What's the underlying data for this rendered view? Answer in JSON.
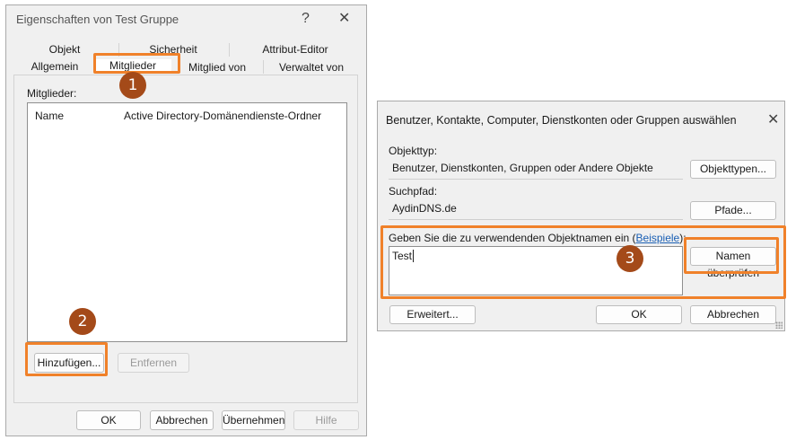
{
  "left_dialog": {
    "title": "Eigenschaften von Test Gruppe",
    "help_glyph": "?",
    "close_glyph": "✕",
    "tabs_row1": [
      "Objekt",
      "Sicherheit",
      "Attribut-Editor"
    ],
    "tabs_row2": [
      "Allgemein",
      "Mitglieder",
      "Mitglied von",
      "Verwaltet von"
    ],
    "members_label": "Mitglieder:",
    "columns": [
      "Name",
      "Active Directory-Domänendienste-Ordner"
    ],
    "add_button": "Hinzufügen...",
    "remove_button": "Entfernen",
    "ok_button": "OK",
    "cancel_button": "Abbrechen",
    "apply_button": "Übernehmen",
    "help_button": "Hilfe"
  },
  "right_dialog": {
    "title": "Benutzer, Kontakte, Computer, Dienstkonten oder Gruppen auswählen",
    "close_glyph": "✕",
    "object_type_label": "Objekttyp:",
    "object_type_value": "Benutzer, Dienstkonten, Gruppen oder Andere Objekte",
    "object_types_button": "Objekttypen...",
    "search_path_label": "Suchpfad:",
    "search_path_value": "AydinDNS.de",
    "paths_button": "Pfade...",
    "enter_names_label": "Geben Sie die zu verwendenden Objektnamen ein (",
    "examples_link": "Beispiele",
    "enter_names_suffix": "):",
    "names_value": "Test",
    "check_names_button": "Namen überprüfen",
    "advanced_button": "Erweitert...",
    "ok_button": "OK",
    "cancel_button": "Abbrechen"
  },
  "annotations": {
    "badge_1": "1",
    "badge_2": "2",
    "badge_3": "3",
    "callout_color": "#f0812a",
    "badge_color": "#a44a19"
  }
}
